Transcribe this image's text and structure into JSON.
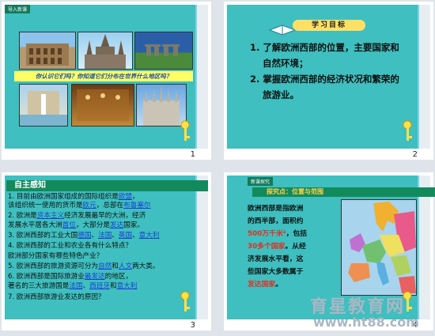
{
  "slide1": {
    "tag": "导入新课",
    "banner": "你认识它们吗？你知道它们分布在世界什么地区吗？",
    "number": "1"
  },
  "slide2": {
    "pill": "学习目标",
    "goals": [
      {
        "line1": "1. 了解欧洲西部的位置，主要国家和",
        "line2": "自然环境；"
      },
      {
        "line1": "2. 掌握欧洲西部的经济状况和繁荣的",
        "line2": "旅游业。"
      }
    ],
    "number": "2"
  },
  "slide3": {
    "title": "自主感知",
    "q": [
      {
        "pre": "1. 目前由欧洲国家组成的国际组织是",
        "a": "欧盟",
        "post": "，"
      },
      {
        "pre": "    该组织统一使用的货币是",
        "a": "欧元",
        "mid": "，总部在",
        "a2": "布鲁塞尔"
      },
      {
        "pre": "2. 欧洲是",
        "a": "资本主义",
        "mid": "经济发展最早的大洲，经济"
      },
      {
        "pre": "    发展水平居各大洲",
        "a": "首位",
        "mid": "，大部分是",
        "a2": "发达",
        "post": "国家。"
      },
      {
        "pre": "3. 欧洲西部的工业大国",
        "a": "德国",
        "mid": "、",
        "a2": "法国",
        "mid2": "、",
        "a3": "英国",
        "mid3": "、",
        "a4": "意大利"
      },
      {
        "pre": "4. 欧洲西部的工业和农业各有什么特点？"
      },
      {
        "pre": "    欧洲部分国家有哪些特色产业？"
      },
      {
        "pre": "5. 欧洲西部的旅游资源可分为",
        "a": "自然",
        "mid": "和",
        "a2": "人文",
        "post": "两大类。"
      },
      {
        "pre": "6. 欧洲西部是国际旅游业",
        "a": "最发达",
        "post": "的地区，"
      },
      {
        "pre": "    著名的三大旅游国是",
        "a": "法国",
        "mid": "、",
        "a2": "西班牙",
        "mid2": "和",
        "a3": "意大利"
      },
      {
        "pre": "7. 欧洲西部旅游业发达的原因？"
      }
    ],
    "number": "3"
  },
  "slide4": {
    "tag": "新课探究",
    "header": "探究点：位置与范围",
    "l1": "欧洲西部是指欧洲",
    "l2": "的西半部，面积约",
    "l3a": "500万千米²",
    "l3b": "，包括",
    "l4a": "30多个国家",
    "l4b": "。从经",
    "l5": "济发展水平看，这",
    "l6": "些国家大多数属于",
    "l7": "发达国家",
    "l7b": "。",
    "number": "4"
  },
  "watermark": {
    "cn": "育星教育网",
    "url": "www.ht88.com"
  }
}
